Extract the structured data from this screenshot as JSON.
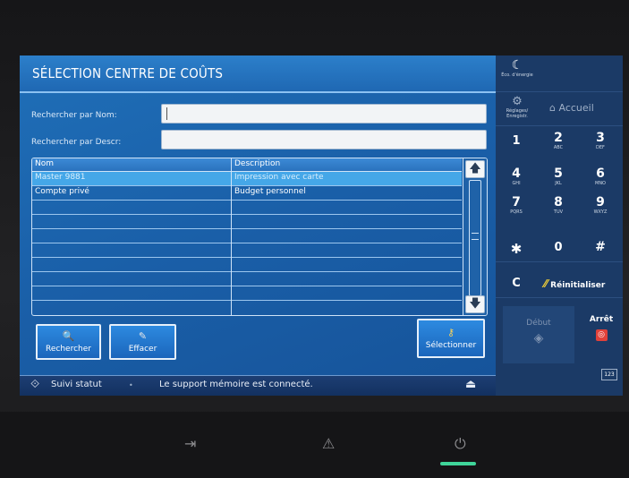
{
  "header": {
    "title": "SÉLECTION CENTRE DE COÛTS"
  },
  "search": {
    "name_label": "Rechercher par Nom:",
    "name_value": "",
    "descr_label": "Rechercher par Descr:",
    "descr_value": ""
  },
  "table": {
    "columns": [
      "Nom",
      "Description"
    ],
    "rows": [
      {
        "name": "Master 9881",
        "description": "Impression avec carte",
        "selected": true
      },
      {
        "name": "Compte privé",
        "description": "Budget personnel",
        "selected": false
      }
    ]
  },
  "buttons": {
    "search": "Rechercher",
    "clear": "Effacer",
    "select": "Sélectionner"
  },
  "status_bar": {
    "job_status": "Suivi statut",
    "message": "Le support mémoire est connecté."
  },
  "side_panel": {
    "eco": "Éco. d'énergie",
    "settings": "Réglages/ Enregistr.",
    "home": "Accueil",
    "keys": [
      {
        "num": "1",
        "letters": ""
      },
      {
        "num": "2",
        "letters": "ABC"
      },
      {
        "num": "3",
        "letters": "DEF"
      },
      {
        "num": "4",
        "letters": "GHI"
      },
      {
        "num": "5",
        "letters": "JKL"
      },
      {
        "num": "6",
        "letters": "MNO"
      },
      {
        "num": "7",
        "letters": "PQRS"
      },
      {
        "num": "8",
        "letters": "TUV"
      },
      {
        "num": "9",
        "letters": "WXYZ"
      },
      {
        "num": "✱",
        "letters": ""
      },
      {
        "num": "0",
        "letters": ""
      },
      {
        "num": "#",
        "letters": ""
      }
    ],
    "clear_key": "C",
    "reset": "Réinitialiser",
    "start": "Début",
    "stop": "Arrêt",
    "keyboard": "123"
  },
  "colors": {
    "screen_blue": "#1a5fa8",
    "panel_navy": "#1b3a66",
    "selected_row": "#45a7e8",
    "stop_red": "#e0413a",
    "accent_yellow": "#f2d037"
  }
}
